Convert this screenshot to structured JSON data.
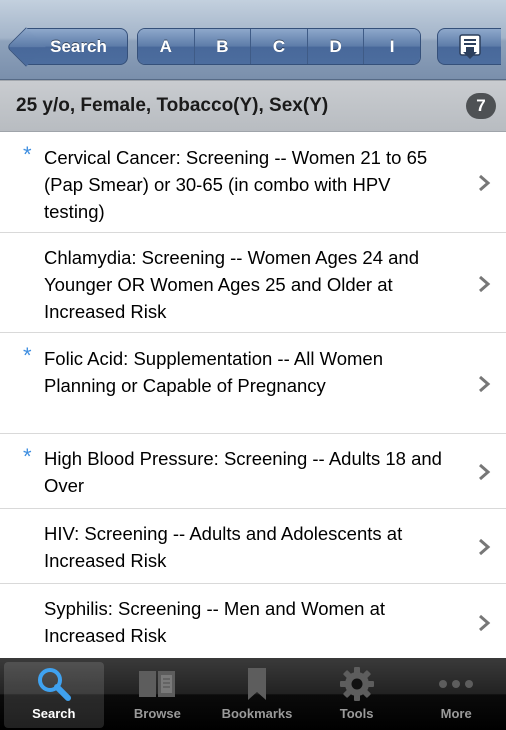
{
  "navbar": {
    "back_label": "Search",
    "segments": [
      "A",
      "B",
      "C",
      "D",
      "I"
    ],
    "action_icon": "export-icon"
  },
  "section": {
    "title": "25 y/o, Female, Tobacco(Y), Sex(Y)",
    "count": "7"
  },
  "rows": [
    {
      "starred": true,
      "text": "Cervical Cancer: Screening -- Women 21 to 65 (Pap Smear) or 30-65 (in combo with HPV testing)"
    },
    {
      "starred": false,
      "text": "Chlamydia: Screening -- Women Ages 24 and Younger OR Women Ages 25 and Older at Increased Risk"
    },
    {
      "starred": true,
      "text": "Folic Acid: Supplementation -- All Women Planning or Capable of Pregnancy"
    },
    {
      "starred": true,
      "text": "High Blood Pressure: Screening -- Adults 18 and Over"
    },
    {
      "starred": false,
      "text": "HIV: Screening -- Adults and Adolescents at Increased Risk"
    },
    {
      "starred": false,
      "text": "Syphilis: Screening -- Men and Women at Increased Risk"
    }
  ],
  "star_glyph": "*",
  "star_color": "#3e8ee0",
  "tabs": [
    {
      "label": "Search",
      "icon": "magnifier-icon",
      "active": true
    },
    {
      "label": "Browse",
      "icon": "book-icon",
      "active": false
    },
    {
      "label": "Bookmarks",
      "icon": "bookmark-icon",
      "active": false
    },
    {
      "label": "Tools",
      "icon": "gear-icon",
      "active": false
    },
    {
      "label": "More",
      "icon": "ellipsis-icon",
      "active": false
    }
  ]
}
